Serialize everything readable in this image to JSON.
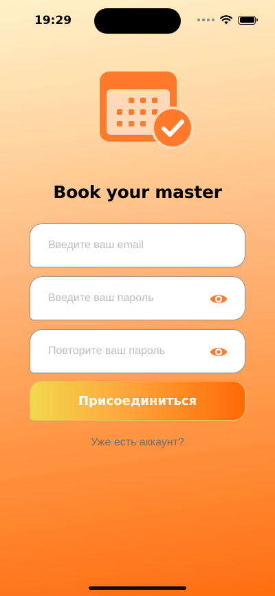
{
  "status_bar": {
    "time": "19:29"
  },
  "app": {
    "title": "Book your master",
    "logo_icon": "calendar-check-icon",
    "accent_color": "#ff7a2a"
  },
  "form": {
    "email_placeholder": "Введите ваш email",
    "password_placeholder": "Введите ваш пароль",
    "repeat_password_placeholder": "Повторите ваш пароль",
    "eye_icon": "eye-icon",
    "submit_label": "Присоединиться",
    "login_link": "Уже есть аккаунт?"
  }
}
